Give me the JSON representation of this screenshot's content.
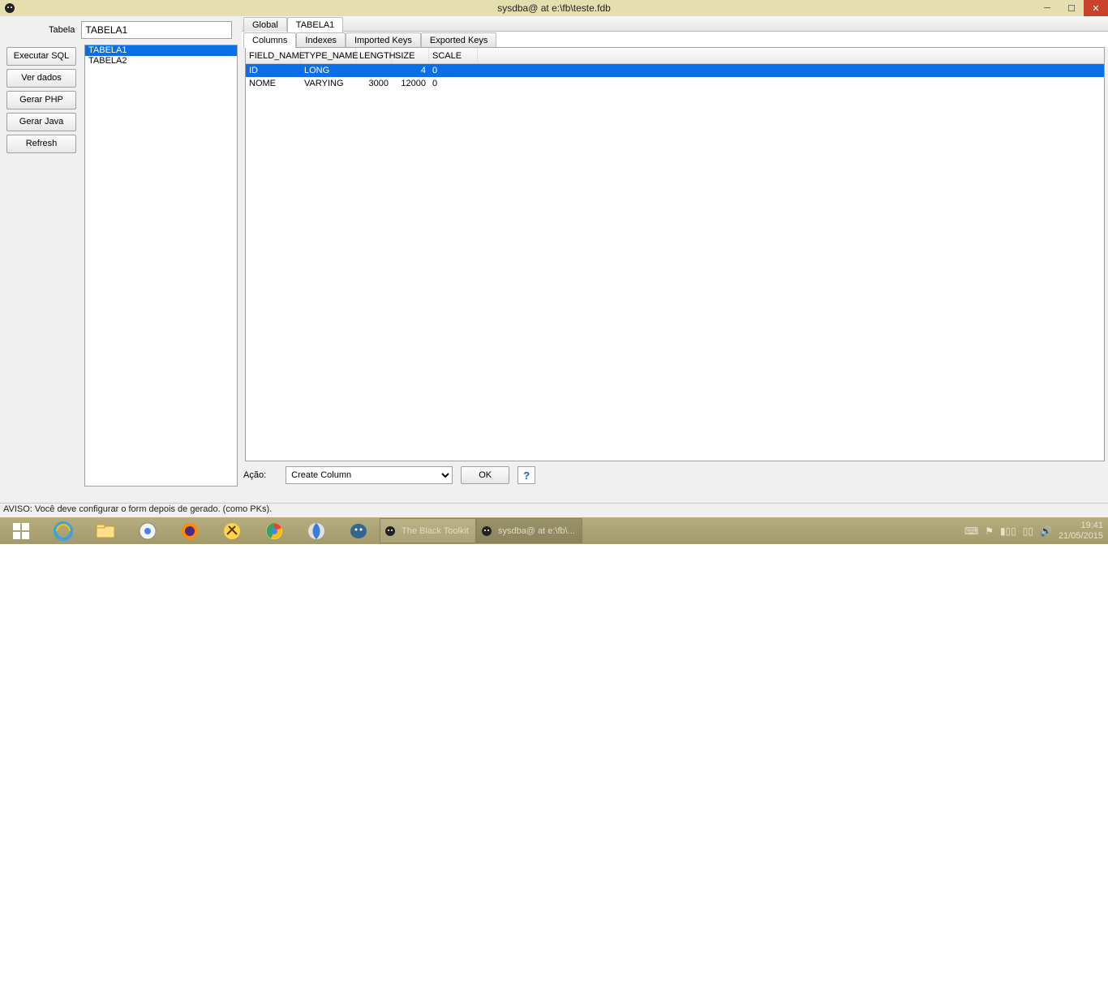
{
  "window": {
    "title": "sysdba@ at e:\\fb\\teste.fdb"
  },
  "sidebar": {
    "table_label": "Tabela",
    "table_value": "TABELA1",
    "buttons": {
      "executar": "Executar SQL",
      "verdados": "Ver dados",
      "gerarphp": "Gerar PHP",
      "gerarjava": "Gerar Java",
      "refresh": "Refresh"
    },
    "tables": [
      "TABELA1",
      "TABELA2"
    ]
  },
  "tabs": {
    "main": [
      "Global",
      "TABELA1"
    ],
    "main_active": 1,
    "sub": [
      "Columns",
      "Indexes",
      "Imported Keys",
      "Exported Keys"
    ],
    "sub_active": 0
  },
  "grid": {
    "headers": [
      "FIELD_NAME",
      "TYPE_NAME",
      "LENGTH",
      "SIZE",
      "SCALE"
    ],
    "rows": [
      {
        "field_name": "ID",
        "type_name": "LONG",
        "length": "",
        "size": "4",
        "scale": "0",
        "selected": true
      },
      {
        "field_name": "NOME",
        "type_name": "VARYING",
        "length": "3000",
        "size": "12000",
        "scale": "0",
        "selected": false
      }
    ]
  },
  "action": {
    "label": "Ação:",
    "selected": "Create Column",
    "ok": "OK"
  },
  "status": "AVISO: Você deve configurar o form depois de gerado. (como PKs).",
  "taskbar": {
    "tasks": [
      {
        "label": "The Black Toolkit"
      },
      {
        "label": "sysdba@ at e:\\fb\\..."
      }
    ],
    "time": "19:41",
    "date": "21/05/2015"
  }
}
